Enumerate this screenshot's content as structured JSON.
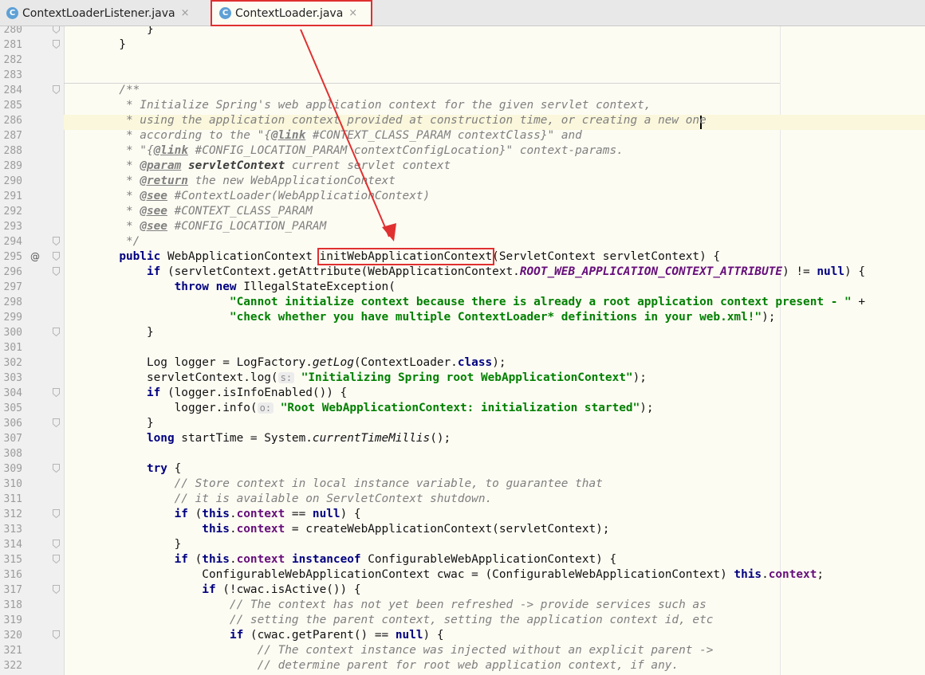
{
  "tabs": [
    {
      "label": "ContextLoaderListener.java",
      "icon": "C",
      "active": false
    },
    {
      "label": "ContextLoader.java",
      "icon": "C",
      "active": true
    }
  ],
  "close_glyph": "×",
  "gutter_marks": {
    "295": "@"
  },
  "lines": [
    {
      "n": "280",
      "t": [
        [
          "",
          "            }"
        ]
      ]
    },
    {
      "n": "281",
      "t": [
        [
          "",
          "        }"
        ]
      ]
    },
    {
      "n": "282",
      "t": []
    },
    {
      "n": "283",
      "t": []
    },
    {
      "n": "284",
      "t": [
        [
          "cm",
          "        /**"
        ]
      ]
    },
    {
      "n": "285",
      "t": [
        [
          "cm",
          "         * Initialize Spring's web application context for the given servlet context,"
        ]
      ]
    },
    {
      "n": "286",
      "t": [
        [
          "cm",
          "         * using the application context provided at construction time, or creating a new one"
        ]
      ]
    },
    {
      "n": "287",
      "t": [
        [
          "cm",
          "         * according to the \"{"
        ],
        [
          "dt",
          "@link"
        ],
        [
          "cm",
          " #CONTEXT_CLASS_PARAM contextClass}\" and"
        ]
      ]
    },
    {
      "n": "288",
      "t": [
        [
          "cm",
          "         * \"{"
        ],
        [
          "dt",
          "@link"
        ],
        [
          "cm",
          " #CONFIG_LOCATION_PARAM contextConfigLocation}\" context-params."
        ]
      ]
    },
    {
      "n": "289",
      "t": [
        [
          "cm",
          "         * "
        ],
        [
          "dt",
          "@param"
        ],
        [
          "cm",
          " "
        ],
        [
          "dn",
          "servletContext"
        ],
        [
          "cm",
          " current servlet context"
        ]
      ]
    },
    {
      "n": "290",
      "t": [
        [
          "cm",
          "         * "
        ],
        [
          "dt",
          "@return"
        ],
        [
          "cm",
          " the new WebApplicationContext"
        ]
      ]
    },
    {
      "n": "291",
      "t": [
        [
          "cm",
          "         * "
        ],
        [
          "dt",
          "@see"
        ],
        [
          "cm",
          " #ContextLoader(WebApplicationContext)"
        ]
      ]
    },
    {
      "n": "292",
      "t": [
        [
          "cm",
          "         * "
        ],
        [
          "dt",
          "@see"
        ],
        [
          "cm",
          " #CONTEXT_CLASS_PARAM"
        ]
      ]
    },
    {
      "n": "293",
      "t": [
        [
          "cm",
          "         * "
        ],
        [
          "dt",
          "@see"
        ],
        [
          "cm",
          " #CONFIG_LOCATION_PARAM"
        ]
      ]
    },
    {
      "n": "294",
      "t": [
        [
          "cm",
          "         */"
        ]
      ]
    },
    {
      "n": "295",
      "t": [
        [
          "",
          "        "
        ],
        [
          "kw",
          "public"
        ],
        [
          "",
          " WebApplicationContext initWebApplicationContext(ServletContext servletContext) {"
        ]
      ]
    },
    {
      "n": "296",
      "t": [
        [
          "",
          "            "
        ],
        [
          "kw",
          "if"
        ],
        [
          "",
          " (servletContext.getAttribute(WebApplicationContext."
        ],
        [
          "fs",
          "ROOT_WEB_APPLICATION_CONTEXT_ATTRIBUTE"
        ],
        [
          "",
          ") != "
        ],
        [
          "kw",
          "null"
        ],
        [
          "",
          ") {"
        ]
      ]
    },
    {
      "n": "297",
      "t": [
        [
          "",
          "                "
        ],
        [
          "kw",
          "throw new"
        ],
        [
          "",
          " IllegalStateException("
        ]
      ]
    },
    {
      "n": "298",
      "t": [
        [
          "",
          "                        "
        ],
        [
          "st",
          "\"Cannot initialize context because there is already a root application context present - \""
        ],
        [
          "",
          " +"
        ]
      ]
    },
    {
      "n": "299",
      "t": [
        [
          "",
          "                        "
        ],
        [
          "st",
          "\"check whether you have multiple ContextLoader* definitions in your web.xml!\""
        ],
        [
          "",
          ");"
        ]
      ]
    },
    {
      "n": "300",
      "t": [
        [
          "",
          "            }"
        ]
      ]
    },
    {
      "n": "301",
      "t": []
    },
    {
      "n": "302",
      "t": [
        [
          "",
          "            Log logger = LogFactory."
        ],
        [
          "it",
          "getLog"
        ],
        [
          "",
          "(ContextLoader."
        ],
        [
          "kw",
          "class"
        ],
        [
          "",
          ");"
        ]
      ]
    },
    {
      "n": "303",
      "t": [
        [
          "",
          "            servletContext.log("
        ],
        [
          "hint",
          "s:"
        ],
        [
          "",
          " "
        ],
        [
          "st",
          "\"Initializing Spring root WebApplicationContext\""
        ],
        [
          "",
          ");"
        ]
      ]
    },
    {
      "n": "304",
      "t": [
        [
          "",
          "            "
        ],
        [
          "kw",
          "if"
        ],
        [
          "",
          " (logger.isInfoEnabled()) {"
        ]
      ]
    },
    {
      "n": "305",
      "t": [
        [
          "",
          "                logger.info("
        ],
        [
          "hint",
          "o:"
        ],
        [
          "",
          " "
        ],
        [
          "st",
          "\"Root WebApplicationContext: initialization started\""
        ],
        [
          "",
          ");"
        ]
      ]
    },
    {
      "n": "306",
      "t": [
        [
          "",
          "            }"
        ]
      ]
    },
    {
      "n": "307",
      "t": [
        [
          "",
          "            "
        ],
        [
          "kw",
          "long"
        ],
        [
          "",
          " startTime = System."
        ],
        [
          "it",
          "currentTimeMillis"
        ],
        [
          "",
          "();"
        ]
      ]
    },
    {
      "n": "308",
      "t": []
    },
    {
      "n": "309",
      "t": [
        [
          "",
          "            "
        ],
        [
          "kw",
          "try"
        ],
        [
          "",
          " {"
        ]
      ]
    },
    {
      "n": "310",
      "t": [
        [
          "cm",
          "                // Store context in local instance variable, to guarantee that"
        ]
      ]
    },
    {
      "n": "311",
      "t": [
        [
          "cm",
          "                // it is available on ServletContext shutdown."
        ]
      ]
    },
    {
      "n": "312",
      "t": [
        [
          "",
          "                "
        ],
        [
          "kw",
          "if"
        ],
        [
          "",
          " ("
        ],
        [
          "kw",
          "this"
        ],
        [
          "",
          "."
        ],
        [
          "fi",
          "context"
        ],
        [
          "",
          " == "
        ],
        [
          "kw",
          "null"
        ],
        [
          "",
          ") {"
        ]
      ]
    },
    {
      "n": "313",
      "t": [
        [
          "",
          "                    "
        ],
        [
          "kw",
          "this"
        ],
        [
          "",
          "."
        ],
        [
          "fi",
          "context"
        ],
        [
          "",
          " = createWebApplicationContext(servletContext);"
        ]
      ]
    },
    {
      "n": "314",
      "t": [
        [
          "",
          "                }"
        ]
      ]
    },
    {
      "n": "315",
      "t": [
        [
          "",
          "                "
        ],
        [
          "kw",
          "if"
        ],
        [
          "",
          " ("
        ],
        [
          "kw",
          "this"
        ],
        [
          "",
          "."
        ],
        [
          "fi",
          "context"
        ],
        [
          "",
          " "
        ],
        [
          "kw",
          "instanceof"
        ],
        [
          "",
          " ConfigurableWebApplicationContext) {"
        ]
      ]
    },
    {
      "n": "316",
      "t": [
        [
          "",
          "                    ConfigurableWebApplicationContext cwac = (ConfigurableWebApplicationContext) "
        ],
        [
          "kw",
          "this"
        ],
        [
          "",
          "."
        ],
        [
          "fi",
          "context"
        ],
        [
          "",
          ";"
        ]
      ]
    },
    {
      "n": "317",
      "t": [
        [
          "",
          "                    "
        ],
        [
          "kw",
          "if"
        ],
        [
          "",
          " (!cwac.isActive()) {"
        ]
      ]
    },
    {
      "n": "318",
      "t": [
        [
          "cm",
          "                        // The context has not yet been refreshed -> provide services such as"
        ]
      ]
    },
    {
      "n": "319",
      "t": [
        [
          "cm",
          "                        // setting the parent context, setting the application context id, etc"
        ]
      ]
    },
    {
      "n": "320",
      "t": [
        [
          "",
          "                        "
        ],
        [
          "kw",
          "if"
        ],
        [
          "",
          " (cwac.getParent() == "
        ],
        [
          "kw",
          "null"
        ],
        [
          "",
          ") {"
        ]
      ]
    },
    {
      "n": "321",
      "t": [
        [
          "cm",
          "                            // The context instance was injected without an explicit parent ->"
        ]
      ]
    },
    {
      "n": "322",
      "t": [
        [
          "cm",
          "                            // determine parent for root web application context, if any."
        ]
      ]
    }
  ],
  "fold_lines": [
    "280",
    "281",
    "284",
    "294",
    "295",
    "296",
    "300",
    "304",
    "306",
    "309",
    "312",
    "314",
    "315",
    "317",
    "320"
  ]
}
